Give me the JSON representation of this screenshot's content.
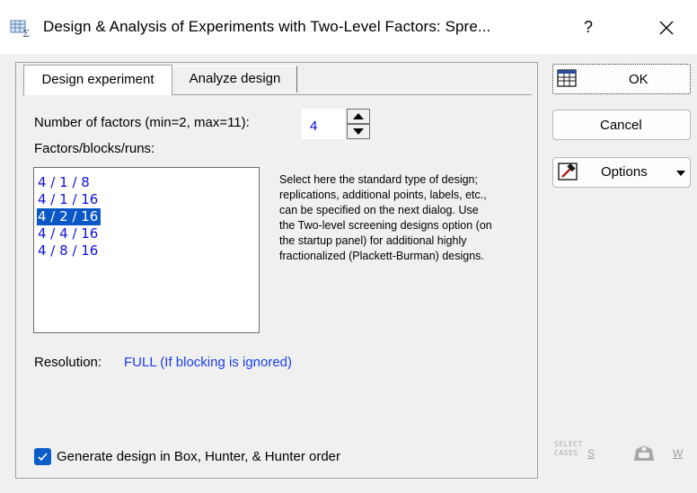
{
  "window": {
    "title": "Design & Analysis of Experiments with Two-Level Factors: Spre...",
    "help_label": "?"
  },
  "tabs": [
    {
      "label": "Design experiment",
      "active": true
    },
    {
      "label": "Analyze design",
      "active": false
    }
  ],
  "design": {
    "num_factors_label": "Number of factors (min=2, max=11):",
    "num_factors_value": "4",
    "fbr_label": "Factors/blocks/runs:",
    "options": [
      "4 / 1 / 8",
      "4 / 1 / 16",
      "4 / 2 / 16",
      "4 / 4 / 16",
      "4 / 8 / 16"
    ],
    "selected_index": 2,
    "help_text": "Select here the standard type of design; replications, additional points, labels, etc., can be specified on the next dialog. Use the Two-level screening designs option (on the startup panel) for additional highly fractionalized (Plackett-Burman) designs.",
    "resolution_label": "Resolution:",
    "resolution_value": "FULL (If blocking is ignored)",
    "generate_checkbox": {
      "label": "Generate design in Box, Hunter, & Hunter order",
      "checked": true
    }
  },
  "buttons": {
    "ok": "OK",
    "cancel": "Cancel",
    "options": "Options"
  },
  "bottom_tools": {
    "select_cases_line1": "SELECT",
    "select_cases_line2": "CASES",
    "select_cases_key": "S",
    "weight_key": "W"
  },
  "colors": {
    "accent": "#0a58c8",
    "value_text": "#1a3df0",
    "list_text": "#1010e0"
  }
}
